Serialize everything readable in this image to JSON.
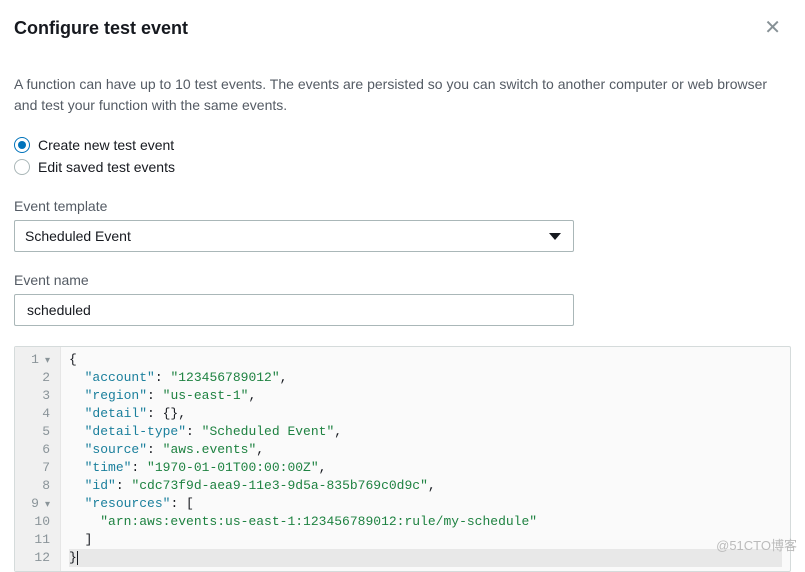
{
  "header": {
    "title": "Configure test event"
  },
  "description": "A function can have up to 10 test events. The events are persisted so you can switch to another computer or web browser and test your function with the same events.",
  "radios": {
    "create_label": "Create new test event",
    "edit_label": "Edit saved test events",
    "selected": "create"
  },
  "template": {
    "label": "Event template",
    "value": "Scheduled Event"
  },
  "name": {
    "label": "Event name",
    "value": "scheduled"
  },
  "editor": {
    "lines": [
      {
        "n": "1",
        "fold": true,
        "indent": 0,
        "segments": [
          {
            "t": "{",
            "c": "p"
          }
        ]
      },
      {
        "n": "2",
        "fold": false,
        "indent": 1,
        "segments": [
          {
            "t": "\"account\"",
            "c": "k"
          },
          {
            "t": ": ",
            "c": "p"
          },
          {
            "t": "\"123456789012\"",
            "c": "s"
          },
          {
            "t": ",",
            "c": "p"
          }
        ]
      },
      {
        "n": "3",
        "fold": false,
        "indent": 1,
        "segments": [
          {
            "t": "\"region\"",
            "c": "k"
          },
          {
            "t": ": ",
            "c": "p"
          },
          {
            "t": "\"us-east-1\"",
            "c": "s"
          },
          {
            "t": ",",
            "c": "p"
          }
        ]
      },
      {
        "n": "4",
        "fold": false,
        "indent": 1,
        "segments": [
          {
            "t": "\"detail\"",
            "c": "k"
          },
          {
            "t": ": {},",
            "c": "p"
          }
        ]
      },
      {
        "n": "5",
        "fold": false,
        "indent": 1,
        "segments": [
          {
            "t": "\"detail-type\"",
            "c": "k"
          },
          {
            "t": ": ",
            "c": "p"
          },
          {
            "t": "\"Scheduled Event\"",
            "c": "s"
          },
          {
            "t": ",",
            "c": "p"
          }
        ]
      },
      {
        "n": "6",
        "fold": false,
        "indent": 1,
        "segments": [
          {
            "t": "\"source\"",
            "c": "k"
          },
          {
            "t": ": ",
            "c": "p"
          },
          {
            "t": "\"aws.events\"",
            "c": "s"
          },
          {
            "t": ",",
            "c": "p"
          }
        ]
      },
      {
        "n": "7",
        "fold": false,
        "indent": 1,
        "segments": [
          {
            "t": "\"time\"",
            "c": "k"
          },
          {
            "t": ": ",
            "c": "p"
          },
          {
            "t": "\"1970-01-01T00:00:00Z\"",
            "c": "s"
          },
          {
            "t": ",",
            "c": "p"
          }
        ]
      },
      {
        "n": "8",
        "fold": false,
        "indent": 1,
        "segments": [
          {
            "t": "\"id\"",
            "c": "k"
          },
          {
            "t": ": ",
            "c": "p"
          },
          {
            "t": "\"cdc73f9d-aea9-11e3-9d5a-835b769c0d9c\"",
            "c": "s"
          },
          {
            "t": ",",
            "c": "p"
          }
        ]
      },
      {
        "n": "9",
        "fold": true,
        "indent": 1,
        "segments": [
          {
            "t": "\"resources\"",
            "c": "k"
          },
          {
            "t": ": [",
            "c": "p"
          }
        ]
      },
      {
        "n": "10",
        "fold": false,
        "indent": 2,
        "segments": [
          {
            "t": "\"arn:aws:events:us-east-1:123456789012:rule/my-schedule\"",
            "c": "s"
          }
        ]
      },
      {
        "n": "11",
        "fold": false,
        "indent": 1,
        "segments": [
          {
            "t": "]",
            "c": "p"
          }
        ]
      },
      {
        "n": "12",
        "fold": false,
        "indent": 0,
        "highlight": true,
        "cursor": true,
        "segments": [
          {
            "t": "}",
            "c": "p"
          }
        ]
      }
    ]
  },
  "watermark": "@51CTO博客"
}
